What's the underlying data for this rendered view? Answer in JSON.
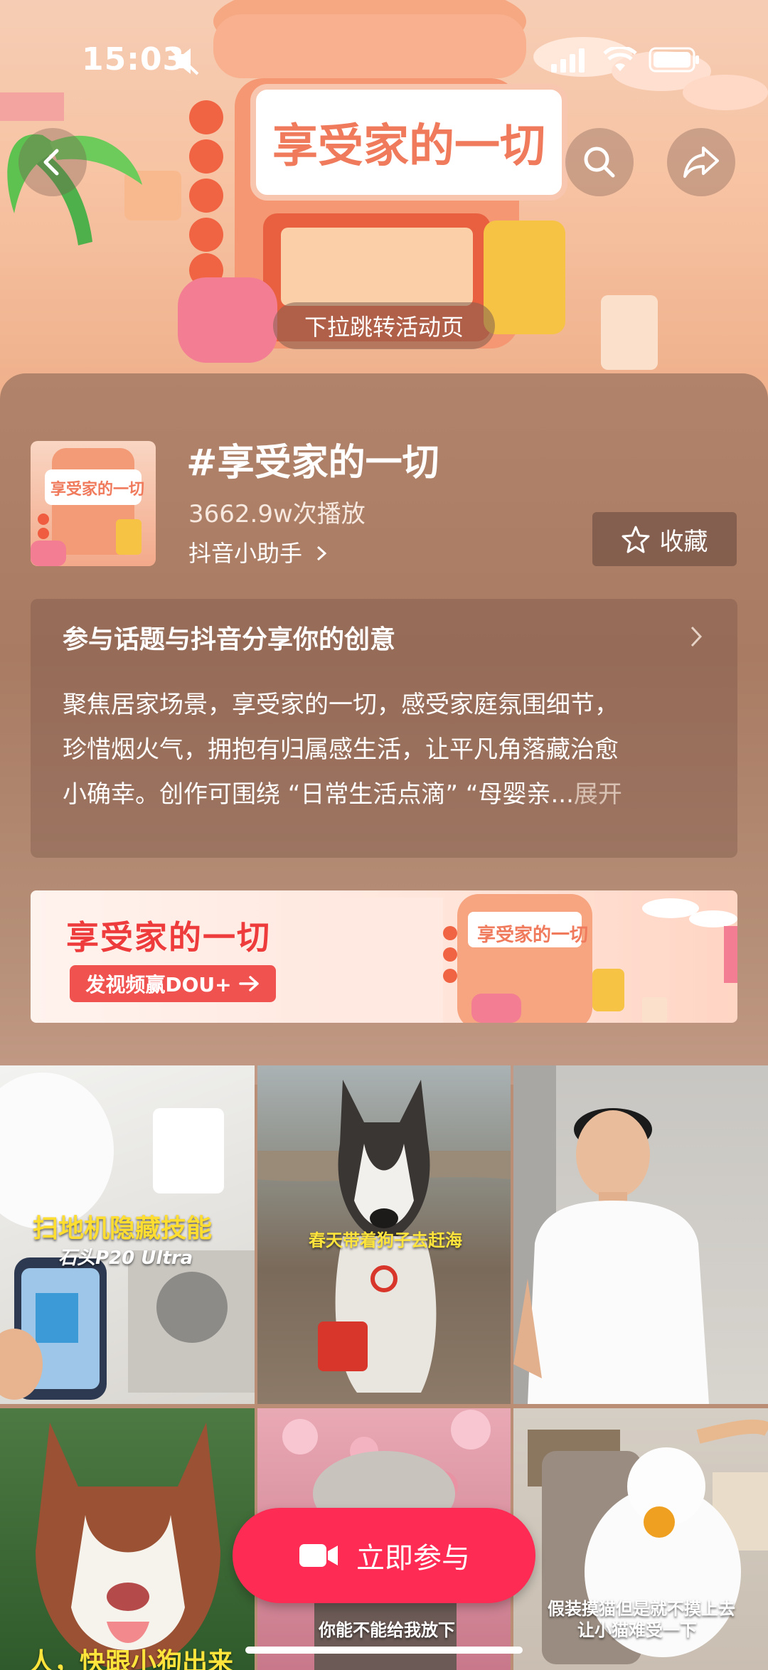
{
  "status_bar": {
    "time": "15:03"
  },
  "hero": {
    "title_sign": "享受家的一切",
    "pull_hint": "下拉跳转活动页"
  },
  "topic": {
    "title": "#享受家的一切",
    "plays": "3662.9w次播放",
    "author": "抖音小助手",
    "favorite_label": "收藏",
    "desc_title": "参与话题与抖音分享你的创意",
    "desc_line1": "聚焦居家场景，享受家的一切，感受家庭氛围细节，",
    "desc_line2": "珍惜烟火气，拥抱有归属感生活，让平凡角落藏治愈",
    "desc_line3": "小确幸。创作可围绕 “日常生活点滴” “母婴亲...",
    "desc_expand": "展开"
  },
  "banner": {
    "title": "享受家的一切",
    "button_label": "发视频赢DOU+",
    "sign": "享受家的一切"
  },
  "videos": [
    {
      "caption1": "扫地机隐藏技能",
      "caption2": "石头P20 Ultra"
    },
    {
      "caption1": "春天带着狗子去赶海"
    },
    {
      "caption1": ""
    },
    {
      "caption1": "人，快跟小狗出来玩"
    },
    {
      "caption1": "你能不能给我放下"
    },
    {
      "caption1": "假装摸猫但是就不摸上去",
      "caption2": "让小猫难受一下"
    }
  ],
  "join_button": {
    "label": "立即参与"
  },
  "colors": {
    "accent": "#fe2b54",
    "banner_red": "#ee3b3b"
  }
}
